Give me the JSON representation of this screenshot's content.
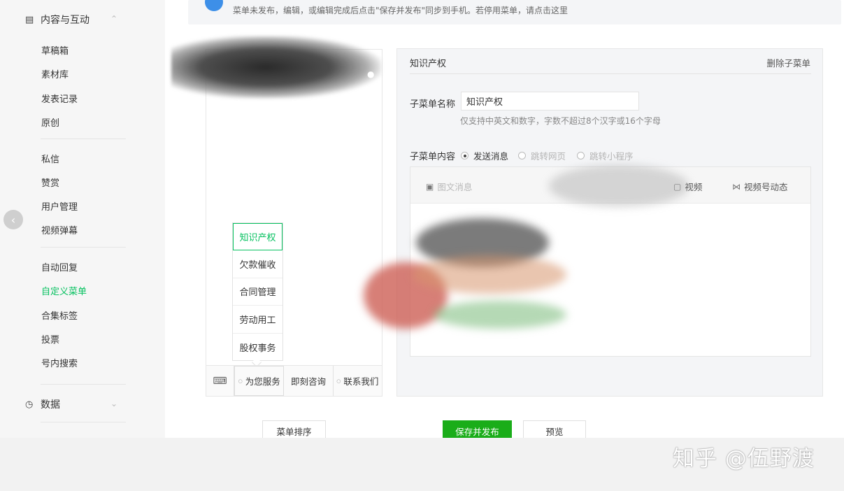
{
  "sidebar": {
    "section_content": {
      "label": "内容与互动",
      "icon": "document-icon"
    },
    "group1": [
      "草稿箱",
      "素材库",
      "发表记录",
      "原创"
    ],
    "group2": [
      "私信",
      "赞赏",
      "用户管理",
      "视频弹幕"
    ],
    "group3": [
      "自动回复",
      "自定义菜单",
      "合集标签",
      "投票",
      "号内搜索"
    ],
    "active_item": "自定义菜单",
    "section_data": {
      "label": "数据",
      "icon": "clock-icon"
    }
  },
  "notice": {
    "text": "菜单未发布，编辑，或编辑完成后点击\"保存并发布\"同步到手机。若停用菜单，请点击这里"
  },
  "phone": {
    "submenu": [
      "知识产权",
      "欠款催收",
      "合同管理",
      "劳动用工",
      "股权事务"
    ],
    "active_submenu": "知识产权",
    "menus": [
      "为您服务",
      "即刻咨询",
      "联系我们"
    ]
  },
  "editor": {
    "title": "知识产权",
    "delete_link": "删除子菜单",
    "name_label": "子菜单名称",
    "name_value": "知识产权",
    "name_hint": "仅支持中英文和数字，字数不超过8个汉字或16个字母",
    "content_label": "子菜单内容",
    "radios": [
      "发送消息",
      "跳转网页",
      "跳转小程序"
    ],
    "selected_radio": "发送消息",
    "tabs": [
      "图文消息",
      "视频",
      "视频号动态"
    ]
  },
  "buttons": {
    "sort": "菜单排序",
    "save_publish": "保存并发布",
    "preview": "预览"
  },
  "watermark": "知乎 @伍野渡",
  "colors": {
    "accent": "#07c160",
    "primary_button": "#1aad19",
    "info": "#3d8fe8"
  }
}
